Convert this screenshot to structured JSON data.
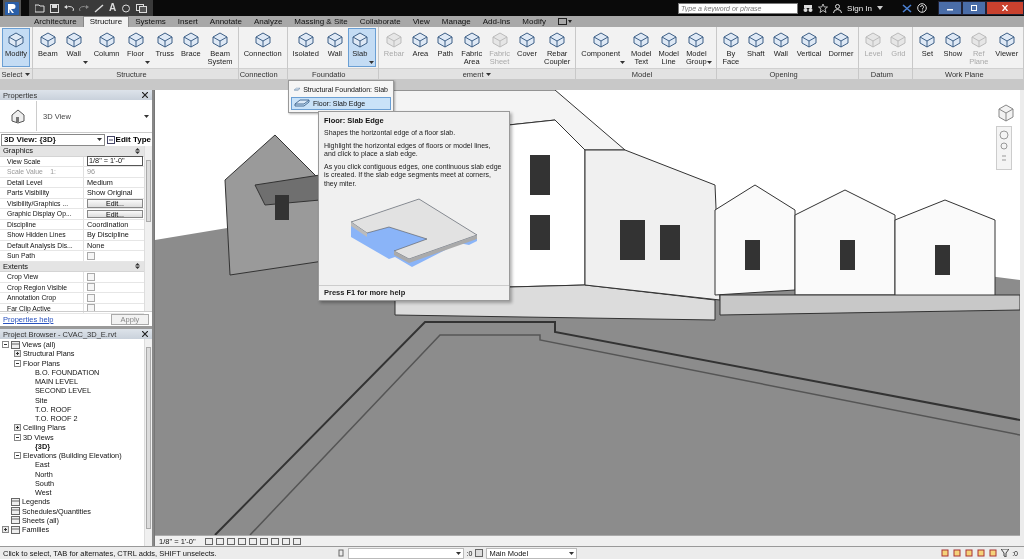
{
  "quick_access": {
    "text_tool": "A"
  },
  "search": {
    "placeholder": "Type a keyword or phrase"
  },
  "sign_in": "Sign In",
  "tabs": [
    {
      "label": "Architecture",
      "selected": false
    },
    {
      "label": "Structure",
      "selected": true
    },
    {
      "label": "Systems",
      "selected": false
    },
    {
      "label": "Insert",
      "selected": false
    },
    {
      "label": "Annotate",
      "selected": false
    },
    {
      "label": "Analyze",
      "selected": false
    },
    {
      "label": "Massing & Site",
      "selected": false
    },
    {
      "label": "Collaborate",
      "selected": false
    },
    {
      "label": "View",
      "selected": false
    },
    {
      "label": "Manage",
      "selected": false
    },
    {
      "label": "Add-Ins",
      "selected": false
    },
    {
      "label": "Modify",
      "selected": false
    }
  ],
  "ribbon": {
    "panels": [
      {
        "label": "Select",
        "menu": true,
        "tools": [
          {
            "label": "Modify",
            "selected": true,
            "disabled": false,
            "menu": false
          }
        ]
      },
      {
        "label": "Structure",
        "menu": false,
        "tools": [
          {
            "label": "Beam",
            "selected": false,
            "disabled": false,
            "menu": false
          },
          {
            "label": "Wall",
            "selected": false,
            "disabled": false,
            "menu": true
          },
          {
            "label": "Column",
            "selected": false,
            "disabled": false,
            "menu": false
          },
          {
            "label": "Floor",
            "selected": false,
            "disabled": false,
            "menu": true
          },
          {
            "label": "Truss",
            "selected": false,
            "disabled": false,
            "menu": false
          },
          {
            "label": "Brace",
            "selected": false,
            "disabled": false,
            "menu": false
          },
          {
            "label": "Beam\nSystem",
            "selected": false,
            "disabled": false,
            "menu": false
          }
        ]
      },
      {
        "label": "Connection",
        "menu": false,
        "tools": [
          {
            "label": "Connection",
            "selected": false,
            "disabled": false,
            "menu": false
          }
        ]
      },
      {
        "label": "Foundatio",
        "menu": false,
        "tools": [
          {
            "label": "Isolated",
            "selected": false,
            "disabled": false,
            "menu": false
          },
          {
            "label": "Wall",
            "selected": false,
            "disabled": false,
            "menu": false
          },
          {
            "label": "Slab",
            "selected": true,
            "disabled": false,
            "menu": true
          }
        ]
      },
      {
        "label": "ement",
        "menu": true,
        "tools": [
          {
            "label": "Rebar",
            "selected": false,
            "disabled": true,
            "menu": false
          },
          {
            "label": "Area",
            "selected": false,
            "disabled": false,
            "menu": false
          },
          {
            "label": "Path",
            "selected": false,
            "disabled": false,
            "menu": false
          },
          {
            "label": "Fabric\nArea",
            "selected": false,
            "disabled": false,
            "menu": false
          },
          {
            "label": "Fabric\nSheet",
            "selected": false,
            "disabled": true,
            "menu": false
          },
          {
            "label": "Cover",
            "selected": false,
            "disabled": false,
            "menu": false
          },
          {
            "label": "Rebar\nCoupler",
            "selected": false,
            "disabled": false,
            "menu": false
          }
        ]
      },
      {
        "label": "Model",
        "menu": false,
        "tools": [
          {
            "label": "Component",
            "selected": false,
            "disabled": false,
            "menu": true
          },
          {
            "label": "Model\nText",
            "selected": false,
            "disabled": false,
            "menu": false
          },
          {
            "label": "Model\nLine",
            "selected": false,
            "disabled": false,
            "menu": false
          },
          {
            "label": "Model\nGroup",
            "selected": false,
            "disabled": false,
            "menu": true
          }
        ]
      },
      {
        "label": "Opening",
        "menu": false,
        "tools": [
          {
            "label": "By\nFace",
            "selected": false,
            "disabled": false,
            "menu": false
          },
          {
            "label": "Shaft",
            "selected": false,
            "disabled": false,
            "menu": false
          },
          {
            "label": "Wall",
            "selected": false,
            "disabled": false,
            "menu": false
          },
          {
            "label": "Vertical",
            "selected": false,
            "disabled": false,
            "menu": false
          },
          {
            "label": "Dormer",
            "selected": false,
            "disabled": false,
            "menu": false
          }
        ]
      },
      {
        "label": "Datum",
        "menu": false,
        "tools": [
          {
            "label": "Level",
            "selected": false,
            "disabled": true,
            "menu": false
          },
          {
            "label": "Grid",
            "selected": false,
            "disabled": true,
            "menu": false
          }
        ]
      },
      {
        "label": "Work Plane",
        "menu": false,
        "tools": [
          {
            "label": "Set",
            "selected": false,
            "disabled": false,
            "menu": false
          },
          {
            "label": "Show",
            "selected": false,
            "disabled": false,
            "menu": false
          },
          {
            "label": "Ref\nPlane",
            "selected": false,
            "disabled": true,
            "menu": false
          },
          {
            "label": "Viewer",
            "selected": false,
            "disabled": false,
            "menu": false
          }
        ]
      }
    ]
  },
  "dropdown": {
    "items": [
      {
        "label": "Structural Foundation: Slab",
        "selected": false
      },
      {
        "label": "Floor: Slab Edge",
        "selected": true
      }
    ]
  },
  "tooltip": {
    "title": "Floor: Slab Edge",
    "paragraphs": [
      "Shapes the horizontal edge of a floor slab.",
      "Highlight the horizontal edges of floors or model lines, and click to place a slab edge.",
      "As you click contiguous edges, one continuous slab edge is created. If the slab edge segments meet at corners, they miter."
    ],
    "footer": "Press F1 for more help"
  },
  "properties": {
    "title": "Properties",
    "type_name": "3D View",
    "instance": "3D View: {3D}",
    "edit_type": "Edit Type",
    "groups": [
      {
        "title": "Graphics",
        "rows": [
          {
            "label": "View Scale",
            "value": "1/8\" = 1'-0\"",
            "kind": "input"
          },
          {
            "label": "Scale Value    1:",
            "value": "96",
            "kind": "readonly"
          },
          {
            "label": "Detail Level",
            "value": "Medium",
            "kind": "text"
          },
          {
            "label": "Parts Visibility",
            "value": "Show Original",
            "kind": "text"
          },
          {
            "label": "Visibility/Graphics ...",
            "value": "Edit...",
            "kind": "button"
          },
          {
            "label": "Graphic Display Op...",
            "value": "Edit...",
            "kind": "button"
          },
          {
            "label": "Discipline",
            "value": "Coordination",
            "kind": "text"
          },
          {
            "label": "Show Hidden Lines",
            "value": "By Discipline",
            "kind": "text"
          },
          {
            "label": "Default Analysis Dis...",
            "value": "None",
            "kind": "text"
          },
          {
            "label": "Sun Path",
            "checked": false,
            "kind": "checkbox"
          }
        ]
      },
      {
        "title": "Extents",
        "rows": [
          {
            "label": "Crop View",
            "checked": false,
            "kind": "checkbox"
          },
          {
            "label": "Crop Region Visible",
            "checked": false,
            "kind": "checkbox"
          },
          {
            "label": "Annotation Crop",
            "checked": false,
            "kind": "checkbox"
          },
          {
            "label": "Far Clip Active",
            "checked": false,
            "kind": "checkbox"
          }
        ]
      }
    ],
    "help_link": "Properties help",
    "apply": "Apply"
  },
  "project_browser": {
    "title": "Project Browser - CVAC_3D_E.rvt",
    "tree": [
      {
        "label": "Views (all)",
        "expanded": true,
        "children": [
          {
            "label": "Structural Plans",
            "expanded": false
          },
          {
            "label": "Floor Plans",
            "expanded": true,
            "children": [
              {
                "label": "B.O. FOUNDATION"
              },
              {
                "label": "MAIN LEVEL"
              },
              {
                "label": "SECOND LEVEL"
              },
              {
                "label": "Site"
              },
              {
                "label": "T.O. ROOF"
              },
              {
                "label": "T.O. ROOF 2"
              }
            ]
          },
          {
            "label": "Ceiling Plans",
            "expanded": false
          },
          {
            "label": "3D Views",
            "expanded": true,
            "children": [
              {
                "label": "{3D}",
                "active": true
              }
            ]
          },
          {
            "label": "Elevations (Building Elevation)",
            "expanded": true,
            "children": [
              {
                "label": "East"
              },
              {
                "label": "North"
              },
              {
                "label": "South"
              },
              {
                "label": "West"
              }
            ]
          }
        ]
      },
      {
        "label": "Legends"
      },
      {
        "label": "Schedules/Quantities"
      },
      {
        "label": "Sheets (all)"
      },
      {
        "label": "Families",
        "expanded": false
      }
    ]
  },
  "view_control": {
    "scale": "1/8\" = 1'-0\""
  },
  "status_bar": {
    "message": "Click to select, TAB for alternates, CTRL adds, SHIFT unselects.",
    "link_count": ":0",
    "workset": "Main Model",
    "filter_count": ":0"
  }
}
